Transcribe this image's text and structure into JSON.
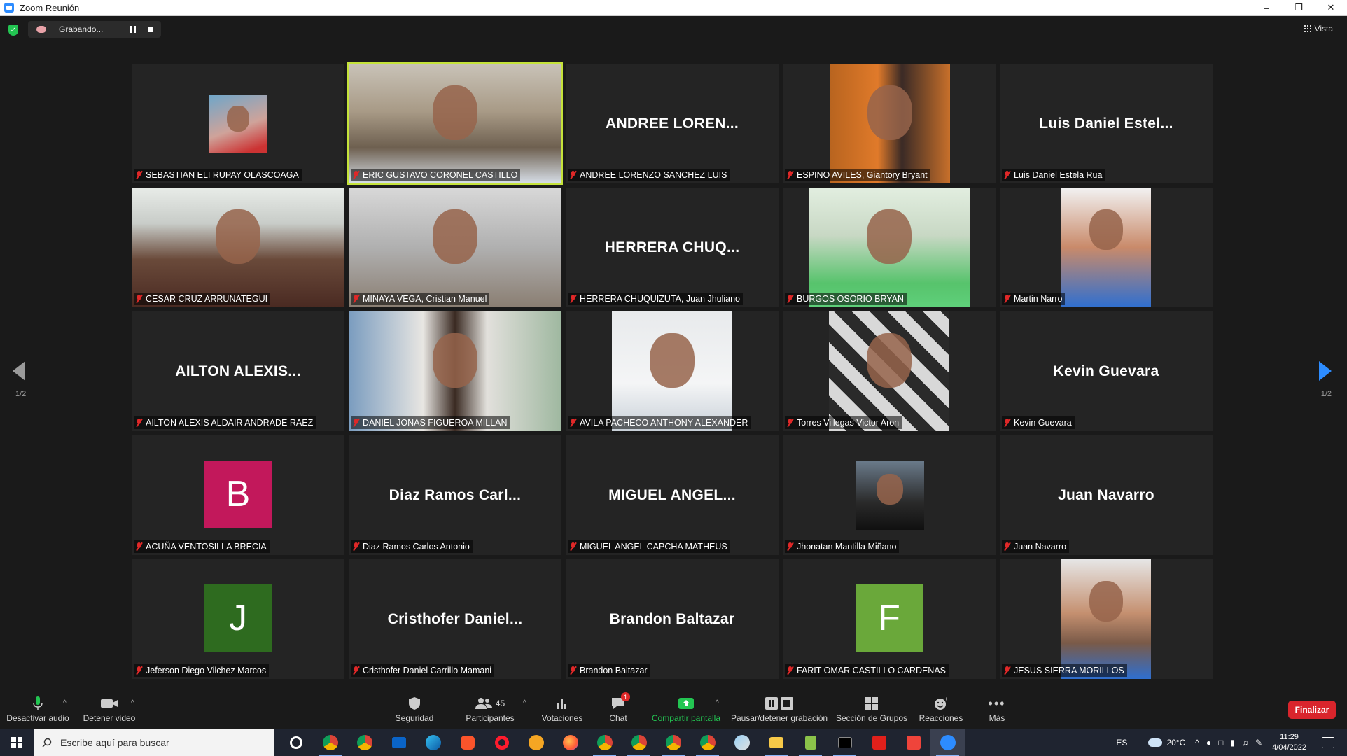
{
  "window": {
    "title": "Zoom Reunión"
  },
  "topbar": {
    "recording_label": "Grabando...",
    "view_label": "Vista"
  },
  "pagination": {
    "left": "1/2",
    "right": "1/2"
  },
  "tiles": [
    {
      "name": "SEBASTIAN ELI RUPAY OLASCOAGA",
      "display": "",
      "type": "video"
    },
    {
      "name": "ERIC GUSTAVO CORONEL CASTILLO",
      "display": "",
      "type": "video",
      "active": true
    },
    {
      "name": "ANDREE LORENZO SANCHEZ LUIS",
      "display": "ANDREE  LOREN...",
      "type": "name"
    },
    {
      "name": "ESPINO AVILES, Giantory Bryant",
      "display": "",
      "type": "video"
    },
    {
      "name": "Luis Daniel Estela Rua",
      "display": "Luis Daniel Estel...",
      "type": "name"
    },
    {
      "name": "CESAR CRUZ ARRUNATEGUI",
      "display": "",
      "type": "video"
    },
    {
      "name": "MINAYA VEGA, Cristian Manuel",
      "display": "",
      "type": "video"
    },
    {
      "name": "HERRERA CHUQUIZUTA, Juan Jhuliano",
      "display": "HERRERA  CHUQ...",
      "type": "name"
    },
    {
      "name": "BURGOS OSORIO BRYAN",
      "display": "",
      "type": "video"
    },
    {
      "name": "Martin Narro",
      "display": "",
      "type": "video"
    },
    {
      "name": "AILTON ALEXIS ALDAIR ANDRADE RAEZ",
      "display": "AILTON  ALEXIS...",
      "type": "name"
    },
    {
      "name": "DANIEL JONAS FIGUEROA MILLAN",
      "display": "",
      "type": "video"
    },
    {
      "name": "AVILA PACHECO ANTHONY ALEXANDER",
      "display": "",
      "type": "video"
    },
    {
      "name": "Torres Villegas Victor Aron",
      "display": "",
      "type": "video"
    },
    {
      "name": "Kevin Guevara",
      "display": "Kevin Guevara",
      "type": "name"
    },
    {
      "name": "ACUÑA VENTOSILLA BRECIA",
      "display": "B",
      "type": "avatar",
      "color": "#c2185b"
    },
    {
      "name": "Diaz Ramos Carlos Antonio",
      "display": "Diaz Ramos Carl...",
      "type": "name"
    },
    {
      "name": "MIGUEL ANGEL CAPCHA MATHEUS",
      "display": "MIGUEL  ANGEL...",
      "type": "name"
    },
    {
      "name": "Jhonatan Mantilla Miñano",
      "display": "",
      "type": "video"
    },
    {
      "name": "Juan Navarro",
      "display": "Juan Navarro",
      "type": "name"
    },
    {
      "name": "Jeferson Diego Vilchez Marcos",
      "display": "J",
      "type": "avatar",
      "color": "#2e6b1f"
    },
    {
      "name": "Cristhofer Daniel Carrillo Mamani",
      "display": "Cristhofer  Daniel...",
      "type": "name"
    },
    {
      "name": "Brandon Baltazar",
      "display": "Brandon Baltazar",
      "type": "name"
    },
    {
      "name": "FARIT OMAR CASTILLO CARDENAS",
      "display": "F",
      "type": "avatar",
      "color": "#6aa83a"
    },
    {
      "name": "JESUS SIERRA MORILLOS",
      "display": "",
      "type": "video"
    }
  ],
  "toolbar": {
    "audio": "Desactivar audio",
    "video": "Detener video",
    "security": "Seguridad",
    "participants": "Participantes",
    "participants_count": "45",
    "polls": "Votaciones",
    "chat": "Chat",
    "chat_badge": "1",
    "share": "Compartir pantalla",
    "record": "Pausar/detener grabación",
    "breakout": "Sección de Grupos",
    "reactions": "Reacciones",
    "more": "Más",
    "end": "Finalizar"
  },
  "taskbar": {
    "search_placeholder": "Escribe aquí para buscar",
    "lang": "ES",
    "temperature": "20°C",
    "time": "11:29",
    "date": "4/04/2022"
  }
}
